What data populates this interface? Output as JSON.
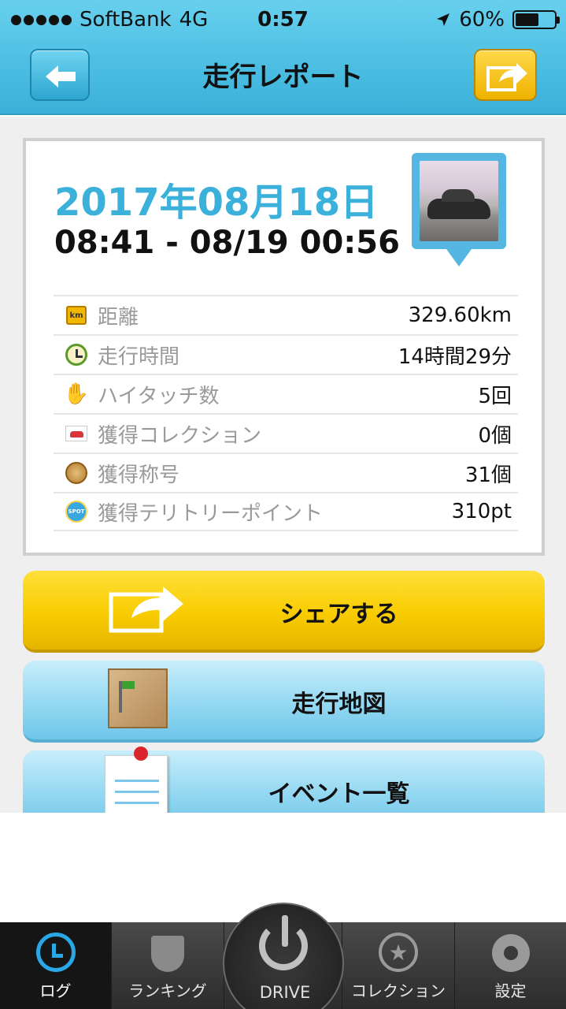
{
  "status": {
    "carrier": "SoftBank",
    "network": "4G",
    "time": "0:57",
    "battery": "60%",
    "battery_level": 0.6
  },
  "header": {
    "title": "走行レポート"
  },
  "report": {
    "date": "2017年08月18日",
    "time_range": "08:41 - 08/19 00:56",
    "rows": [
      {
        "icon": "km-icon",
        "label": "距離",
        "value": "329.60km"
      },
      {
        "icon": "clock-icon",
        "label": "走行時間",
        "value": "14時間29分"
      },
      {
        "icon": "high-five-icon",
        "label": "ハイタッチ数",
        "value": "5回"
      },
      {
        "icon": "car-collection-icon",
        "label": "獲得コレクション",
        "value": "0個"
      },
      {
        "icon": "title-medal-icon",
        "label": "獲得称号",
        "value": "31個"
      },
      {
        "icon": "spot-icon",
        "label": "獲得テリトリーポイント",
        "value": "310pt"
      }
    ]
  },
  "actions": {
    "share": "シェアする",
    "map": "走行地図",
    "events": "イベント一覧"
  },
  "tabs": {
    "log": "ログ",
    "ranking": "ランキング",
    "drive": "DRIVE",
    "collection": "コレクション",
    "settings": "設定"
  }
}
